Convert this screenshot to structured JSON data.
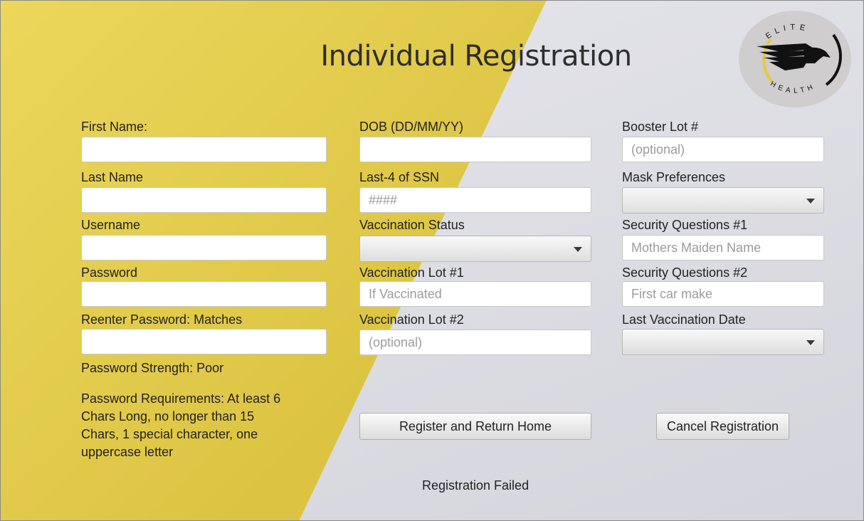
{
  "title": "Individual Registration",
  "logo": {
    "top_text": "ELITE",
    "bottom_text": "HEALTH",
    "icon": "eagle-icon",
    "accent": "#e7c840"
  },
  "colors": {
    "yellow": "#dcc442",
    "grey": "#dcdce2"
  },
  "col1": {
    "first_name_label": "First Name:",
    "last_name_label": "Last Name",
    "username_label": "Username",
    "password_label": "Password",
    "reenter_label": "Reenter Password: Matches",
    "strength": "Password Strength: Poor",
    "requirements": "Password Requirements: At least 6 Chars Long, no longer than 15 Chars, 1 special character, one uppercase letter"
  },
  "col2": {
    "dob_label": "DOB (DD/MM/YY)",
    "ssn_label": "Last-4 of SSN",
    "ssn_placeholder": "####",
    "vax_status_label": "Vaccination Status",
    "lot1_label": "Vaccination Lot #1",
    "lot1_placeholder": "If Vaccinated",
    "lot2_label": "Vaccination Lot #2",
    "lot2_placeholder": "(optional)"
  },
  "col3": {
    "booster_label": "Booster Lot #",
    "booster_placeholder": "(optional)",
    "mask_label": "Mask Preferences",
    "sq1_label": "Security Questions #1",
    "sq1_placeholder": "Mothers Maiden Name",
    "sq2_label": "Security Questions #2",
    "sq2_placeholder": "First car make",
    "last_vax_label": "Last Vaccination Date"
  },
  "buttons": {
    "register": "Register and Return Home",
    "cancel": "Cancel Registration"
  },
  "status": "Registration Failed"
}
